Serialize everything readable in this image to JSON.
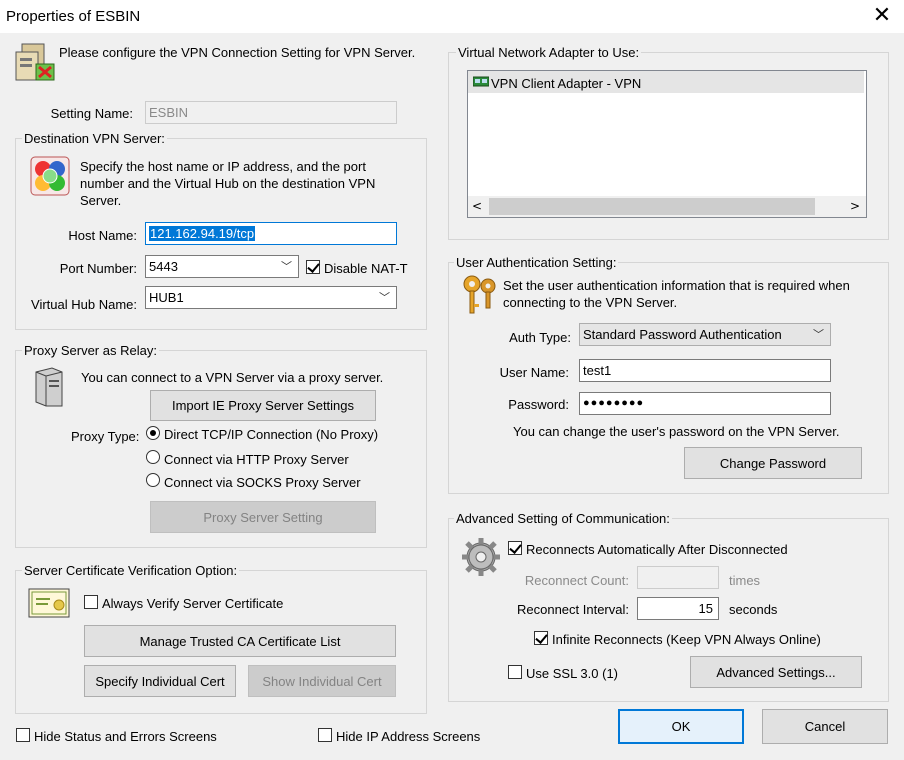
{
  "window": {
    "title": "Properties of ESBIN",
    "intro_text": "Please configure the VPN Connection Setting for VPN Server."
  },
  "setting_name": {
    "label": "Setting Name:",
    "value": "ESBIN"
  },
  "destination": {
    "group_title": "Destination VPN Server:",
    "description": "Specify the host name or IP address, and the port number and the Virtual Hub on the destination VPN Server.",
    "host_label": "Host Name:",
    "host_value": "121.162.94.19/tcp",
    "port_label": "Port Number:",
    "port_value": "5443",
    "disable_natt_label": "Disable NAT-T",
    "hub_label": "Virtual Hub Name:",
    "hub_value": "HUB1"
  },
  "proxy": {
    "group_title": "Proxy Server as Relay:",
    "description": "You can connect to a VPN Server via a proxy server.",
    "import_button": "Import IE Proxy Server Settings",
    "type_label": "Proxy Type:",
    "options": [
      "Direct TCP/IP Connection (No Proxy)",
      "Connect via HTTP Proxy Server",
      "Connect via SOCKS Proxy Server"
    ],
    "setting_button": "Proxy Server Setting"
  },
  "certificate": {
    "group_title": "Server Certificate Verification Option:",
    "always_verify_label": "Always Verify Server Certificate",
    "manage_ca_button": "Manage Trusted CA Certificate List",
    "specify_cert_button": "Specify Individual Cert",
    "show_cert_button": "Show Individual Cert"
  },
  "bottom_checks": {
    "hide_status_label": "Hide Status and Errors Screens",
    "hide_ip_label": "Hide IP Address Screens"
  },
  "adapter": {
    "group_title": "Virtual Network Adapter to Use:",
    "items": [
      "VPN Client Adapter - VPN"
    ]
  },
  "auth": {
    "group_title": "User Authentication Setting:",
    "description": "Set the user authentication information that is required when connecting to the VPN Server.",
    "type_label": "Auth Type:",
    "type_value": "Standard Password Authentication",
    "user_label": "User Name:",
    "user_value": "test1",
    "password_label": "Password:",
    "password_value": "●●●●●●●●",
    "change_note": "You can change the user's password on the VPN Server.",
    "change_button": "Change Password"
  },
  "advanced": {
    "group_title": "Advanced Setting of Communication:",
    "reconnect_auto_label": "Reconnects Automatically After Disconnected",
    "reconnect_count_label": "Reconnect Count:",
    "reconnect_count_value": "",
    "times_label": "times",
    "interval_label": "Reconnect Interval:",
    "interval_value": "15",
    "seconds_label": "seconds",
    "infinite_label": "Infinite Reconnects (Keep VPN Always Online)",
    "ssl_label": "Use SSL 3.0 (1)",
    "advanced_button": "Advanced Settings..."
  },
  "footer": {
    "ok": "OK",
    "cancel": "Cancel"
  },
  "colors": {
    "accent": "#0078d7",
    "selection": "#0078d7"
  }
}
